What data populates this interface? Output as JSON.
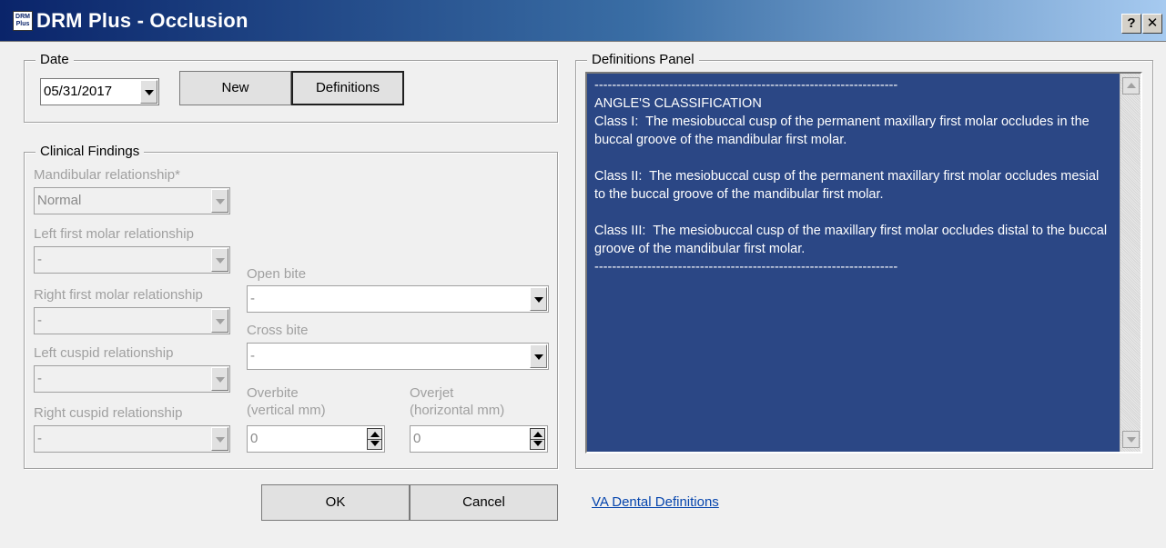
{
  "window": {
    "icon_text": "DRM Plus",
    "title": "DRM Plus - Occlusion",
    "help_label": "?",
    "close_label": "✕"
  },
  "date_group": {
    "legend": "Date",
    "date_value": "05/31/2017",
    "new_label": "New",
    "definitions_label": "Definitions"
  },
  "clinical": {
    "legend": "Clinical Findings",
    "mandibular_label": "Mandibular relationship*",
    "mandibular_value": "Normal",
    "left_molar_label": "Left first molar relationship",
    "left_molar_value": "-",
    "right_molar_label": "Right first molar relationship",
    "right_molar_value": "-",
    "left_cuspid_label": "Left cuspid relationship",
    "left_cuspid_value": "-",
    "right_cuspid_label": "Right cuspid relationship",
    "right_cuspid_value": "-",
    "open_bite_label": "Open bite",
    "open_bite_value": "-",
    "cross_bite_label": "Cross bite",
    "cross_bite_value": "-",
    "overbite_label": "Overbite\n(vertical mm)",
    "overbite_value": "0",
    "overjet_label": "Overjet\n(horizontal mm)",
    "overjet_value": "0"
  },
  "definitions_panel": {
    "legend": "Definitions Panel",
    "text": "---------------------------------------------------------------------\nANGLE'S CLASSIFICATION\nClass I:  The mesiobuccal cusp of the permanent maxillary first molar occludes in the buccal groove of the mandibular first molar.\n\nClass II:  The mesiobuccal cusp of the permanent maxillary first molar occludes mesial to the buccal groove of the mandibular first molar.\n\nClass III:  The mesiobuccal cusp of the maxillary first molar occludes distal to the buccal groove of the mandibular first molar.\n---------------------------------------------------------------------"
  },
  "footer": {
    "ok_label": "OK",
    "cancel_label": "Cancel",
    "link_label": "VA Dental Definitions"
  },
  "colors": {
    "title_gradient_start": "#0a246a",
    "definitions_background": "#2b4785",
    "link": "#0645ad",
    "disabled_text": "#a0a0a0"
  }
}
